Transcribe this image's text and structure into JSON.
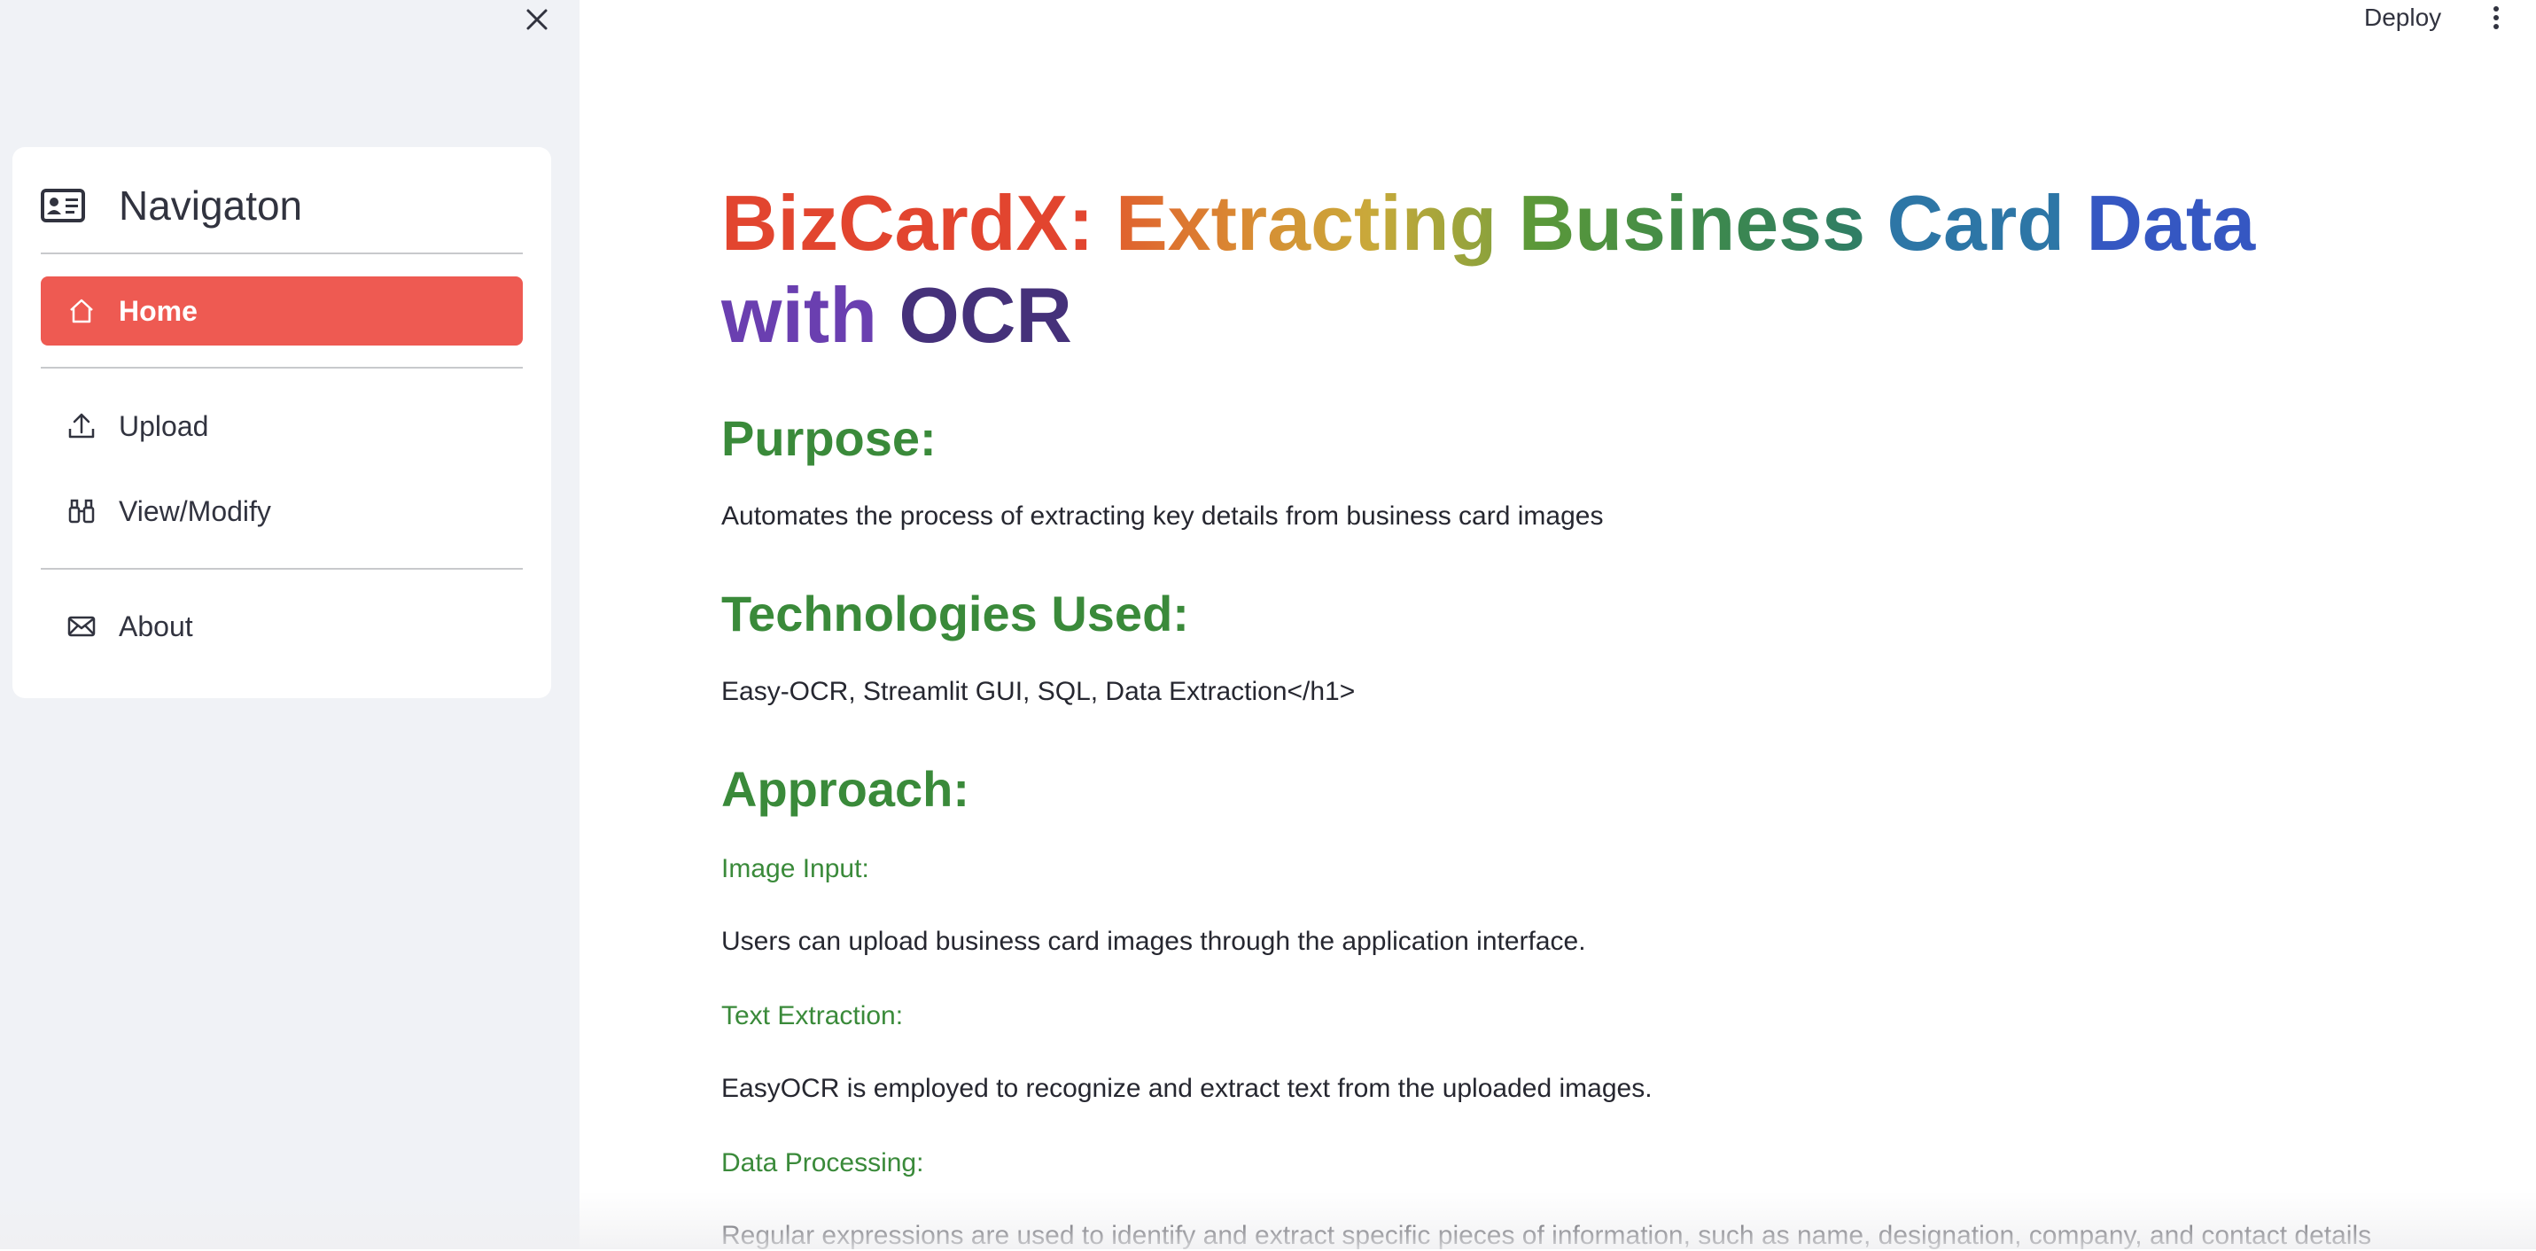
{
  "header": {
    "deploy_label": "Deploy"
  },
  "sidebar": {
    "nav_title": "Navigaton",
    "items": [
      {
        "label": "Home",
        "icon": "house-icon",
        "active": true
      },
      {
        "label": "Upload",
        "icon": "upload-icon",
        "active": false
      },
      {
        "label": "View/Modify",
        "icon": "binoculars-icon",
        "active": false
      },
      {
        "label": "About",
        "icon": "envelope-icon",
        "active": false
      }
    ]
  },
  "main": {
    "title_words": [
      {
        "text": "BizCardX:",
        "color": "#e2452f"
      },
      {
        "text": "Extracting",
        "color": "#d98a33"
      },
      {
        "text": "Business",
        "color": "#4f8a39"
      },
      {
        "text": "Card",
        "color": "#2d76a6"
      },
      {
        "text": "Data",
        "color": "#3557c2"
      },
      {
        "text": "with",
        "color": "#6a3fb0"
      },
      {
        "text": "OCR",
        "color": "#45317a"
      }
    ],
    "purpose_heading": "Purpose:",
    "purpose_text": "Automates the process of extracting key details from business card images",
    "tech_heading": "Technologies Used:",
    "tech_text": "Easy-OCR, Streamlit GUI, SQL, Data Extraction</h1>",
    "approach_heading": "Approach:",
    "steps": [
      {
        "title": "Image Input:",
        "text": "Users can upload business card images through the application interface."
      },
      {
        "title": "Text Extraction:",
        "text": "EasyOCR is employed to recognize and extract text from the uploaded images."
      },
      {
        "title": "Data Processing:",
        "text": "Regular expressions are used to identify and extract specific pieces of information, such as name, designation, company, and contact details"
      }
    ]
  },
  "colors": {
    "accent": "#ee5a52",
    "heading_green": "#3a8a3a",
    "sidebar_bg": "#f0f2f6"
  }
}
